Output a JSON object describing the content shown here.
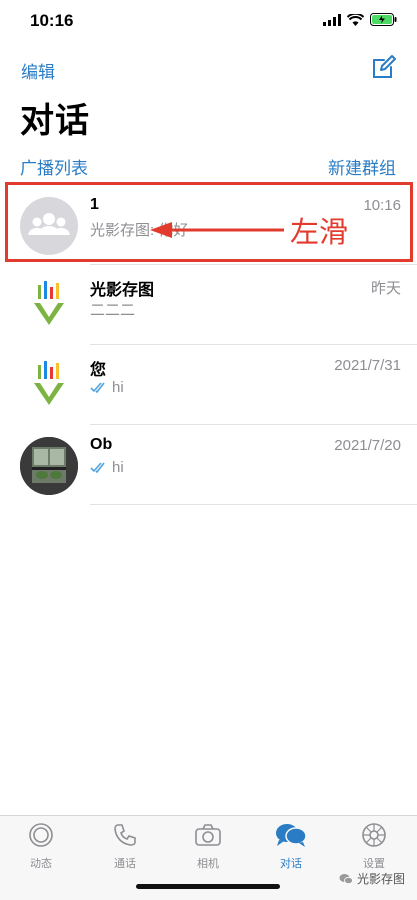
{
  "status_bar": {
    "time": "10:16"
  },
  "nav": {
    "edit_label": "编辑",
    "compose_icon": "compose-icon"
  },
  "title": "对话",
  "links": {
    "broadcast": "广播列表",
    "new_group": "新建群组"
  },
  "chats": [
    {
      "name": "1",
      "time": "10:16",
      "preview": "光影存图: 你好",
      "avatar": "group-avatar"
    },
    {
      "name": "光影存图",
      "time": "昨天",
      "preview": "二二二",
      "avatar": "logo-avatar"
    },
    {
      "name": "您",
      "time": "2021/7/31",
      "preview": "hi",
      "avatar": "logo-avatar",
      "read": true
    },
    {
      "name": "Ob",
      "time": "2021/7/20",
      "preview": "hi",
      "avatar": "photo-avatar",
      "read": true
    }
  ],
  "annotation": {
    "label": "左滑",
    "color": "#e23b2e"
  },
  "tabs": [
    {
      "label": "动态",
      "icon": "status-icon",
      "active": false
    },
    {
      "label": "通话",
      "icon": "phone-icon",
      "active": false
    },
    {
      "label": "相机",
      "icon": "camera-icon",
      "active": false
    },
    {
      "label": "对话",
      "icon": "chat-icon",
      "active": true
    },
    {
      "label": "设置",
      "icon": "gear-icon",
      "active": false
    }
  ],
  "watermark": "光影存图",
  "colors": {
    "accent": "#2a7dc4",
    "annotation": "#e23b2e",
    "secondary_text": "#8e8e93"
  }
}
